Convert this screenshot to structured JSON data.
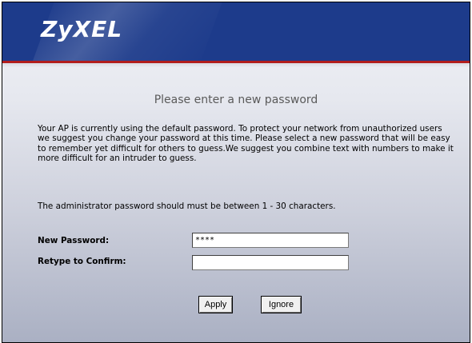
{
  "header": {
    "logo_text": "ZyXEL"
  },
  "page": {
    "title": "Please enter a new password",
    "description": "Your AP is currently using the default password. To protect your network from unauthorized users we suggest you change your password at this time. Please select a new password that will be easy to remember yet difficult for others to guess.We suggest you combine text with numbers to make it more difficult for an intruder to guess.",
    "note": "The administrator password should must be between 1 - 30 characters."
  },
  "form": {
    "new_password_label": "New Password:",
    "new_password_value": "****",
    "confirm_label": "Retype to Confirm:",
    "confirm_value": ""
  },
  "buttons": {
    "apply": "Apply",
    "ignore": "Ignore"
  },
  "colors": {
    "header_blue": "#1d3b8b",
    "accent_red": "#b21d1d"
  }
}
